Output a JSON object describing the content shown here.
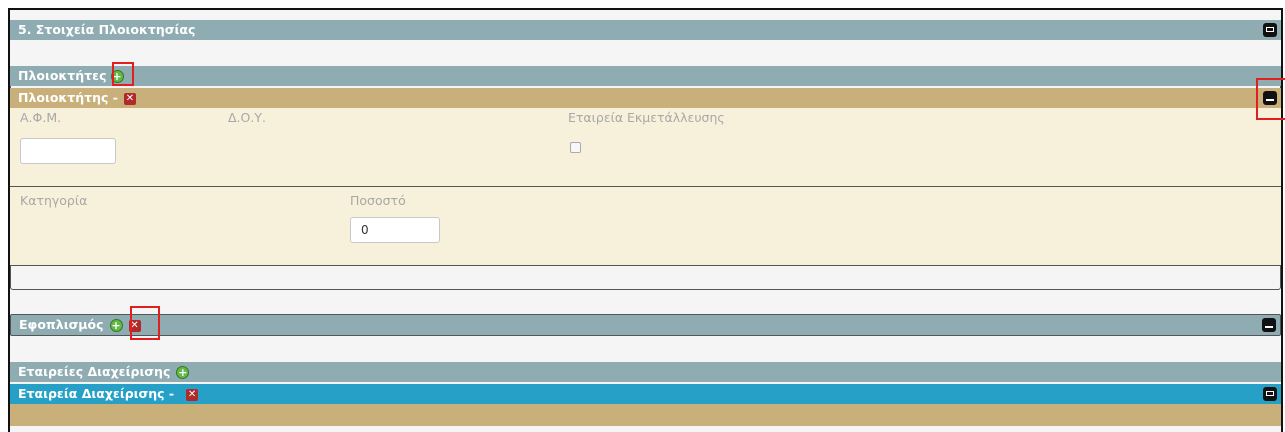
{
  "section": {
    "title": "5. Στοιχεία Πλοιοκτησίας"
  },
  "owners": {
    "title": "Πλοιοκτήτες",
    "owner": {
      "title": "Πλοιοκτήτης -",
      "afm_label": "Α.Φ.Μ.",
      "afm_value": "",
      "doy_label": "Δ.Ο.Υ.",
      "company_label": "Εταιρεία Εκμετάλλευσης",
      "category_label": "Κατηγορία",
      "percent_label": "Ποσοστό",
      "percent_value": "0"
    }
  },
  "outfitting": {
    "title": "Εφοπλισμός"
  },
  "management": {
    "title": "Εταιρείες Διαχείρισης",
    "company_title": "Εταιρεία Διαχείρισης -"
  },
  "icons": {
    "plus": "plus-circle-icon",
    "remove": "remove-x-icon",
    "collapse": "collapse-icon"
  },
  "colors": {
    "gray_bar": "#8facb3",
    "tan_bar": "#c9b07a",
    "blue_bar": "#26a0c7",
    "panel_bg": "#f7f0da",
    "highlight": "#e02020"
  }
}
